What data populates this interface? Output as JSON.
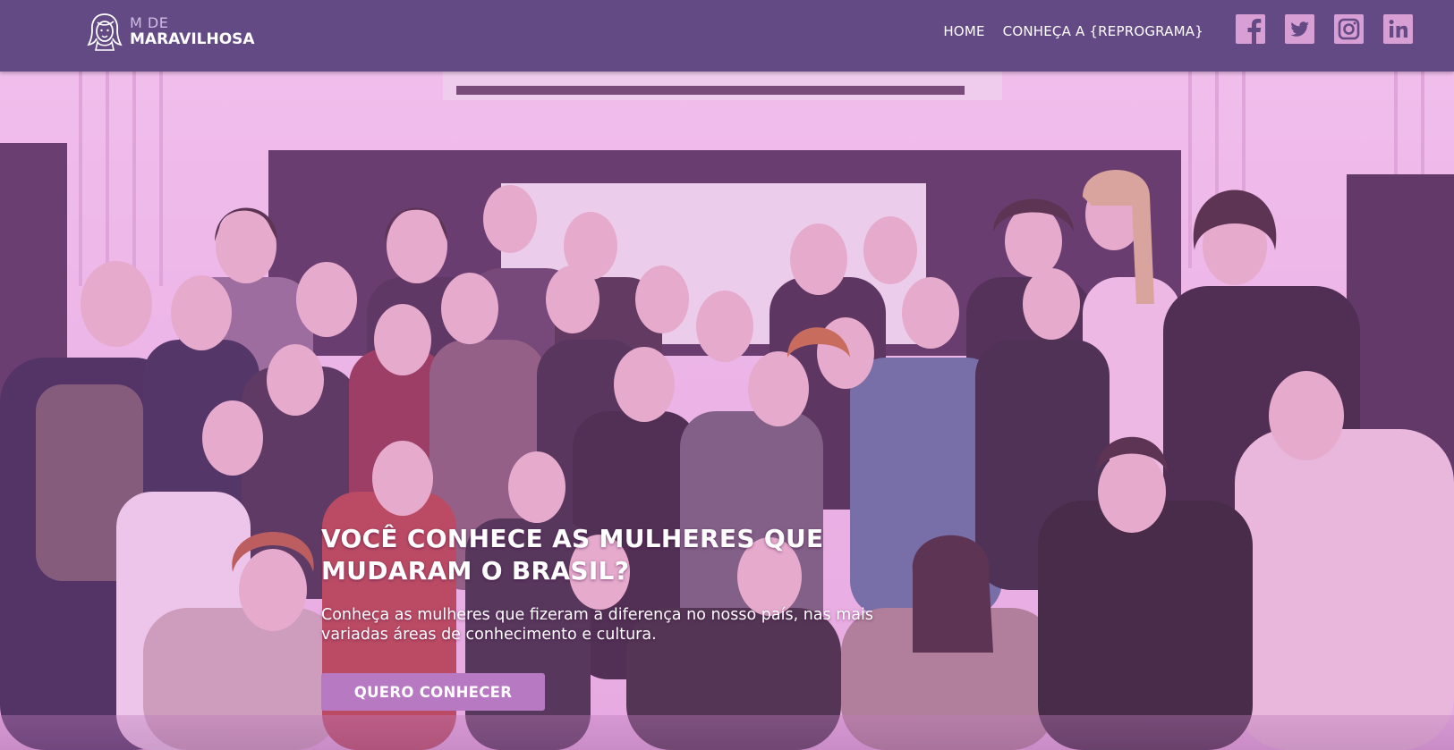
{
  "brand": {
    "logo_top": "M DE",
    "logo_bottom": "MARAVILHOSA",
    "logo_icon": "woman-face-icon"
  },
  "nav": {
    "home": "HOME",
    "reprograma": "CONHEÇA A {REPROGRAMA}"
  },
  "socials": [
    {
      "name": "facebook",
      "icon": "facebook-icon"
    },
    {
      "name": "twitter",
      "icon": "twitter-icon"
    },
    {
      "name": "instagram",
      "icon": "instagram-icon"
    },
    {
      "name": "linkedin",
      "icon": "linkedin-icon"
    }
  ],
  "hero": {
    "title": "VOCÊ CONHECE AS MULHERES QUE MUDARAM O BRASIL?",
    "text": "Conheça as mulheres que fizeram a diferença no nosso país, nas mais variadas áreas de conhecimento e cultura.",
    "cta": "QUERO CONHECER",
    "image": "group-photo-of-women"
  },
  "colors": {
    "header": "#634a85",
    "accent": "#b679c2",
    "social_icon": "#d89fd4",
    "photo_tint": "#e178dc"
  }
}
